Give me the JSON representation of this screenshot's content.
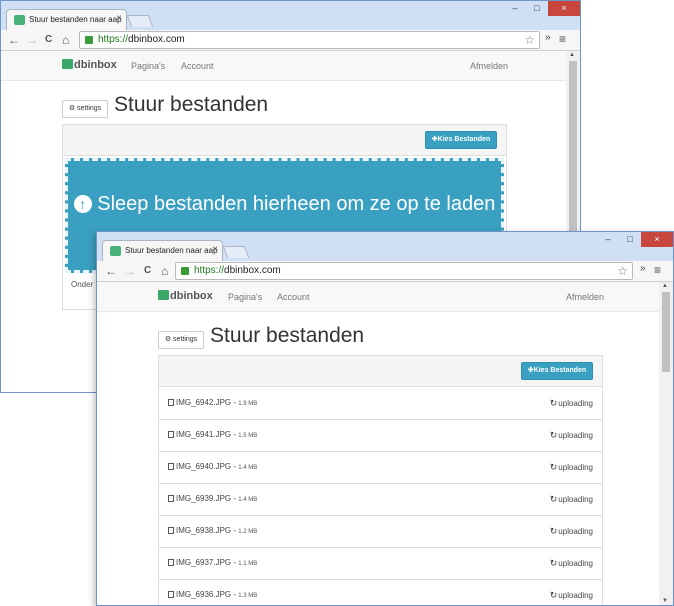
{
  "browser": {
    "tab_title": "Stuur bestanden naar aap",
    "tab_close": "×",
    "url_scheme": "https://",
    "url_host": "dbinbox.com",
    "controls": {
      "minimize": "–",
      "maximize": "□",
      "close": "×"
    },
    "extensions_glyph": "»",
    "menu_glyph": "≡",
    "back_glyph": "←",
    "forward_glyph": "→",
    "reload_glyph": "C",
    "home_glyph": "⌂",
    "star_glyph": "☆"
  },
  "site": {
    "brand": "dbinbox",
    "nav": {
      "pages": "Pagina's",
      "account": "Account",
      "logout": "Afmelden"
    },
    "settings_button": "settings",
    "settings_icon": "gear-icon",
    "page_title": "Stuur bestanden",
    "choose_button": "Kies Bestanden",
    "choose_icon": "plus-icon"
  },
  "back_window": {
    "dropzone_text": "Sleep bestanden hierheen om ze op te laden",
    "dropzone_icon": "upload-arrow-icon",
    "footer_partial": "Onder"
  },
  "files": [
    {
      "name": "IMG_6942.JPG",
      "sep": " - ",
      "size": "1.9 MB",
      "status": "uploading"
    },
    {
      "name": "IMG_6941.JPG",
      "sep": " - ",
      "size": "1.5 MB",
      "status": "uploading"
    },
    {
      "name": "IMG_6940.JPG",
      "sep": " - ",
      "size": "1.4 MB",
      "status": "uploading"
    },
    {
      "name": "IMG_6939.JPG",
      "sep": " - ",
      "size": "1.4 MB",
      "status": "uploading"
    },
    {
      "name": "IMG_6938.JPG",
      "sep": " - ",
      "size": "1.2 MB",
      "status": "uploading"
    },
    {
      "name": "IMG_6937.JPG",
      "sep": " - ",
      "size": "1.1 MB",
      "status": "uploading"
    },
    {
      "name": "IMG_6936.JPG",
      "sep": " - ",
      "size": "1.3 MB",
      "status": "uploading"
    }
  ],
  "colors": {
    "accent": "#3aa0c2",
    "brand_green": "#3aa869",
    "titlebar": "#cfe0f5",
    "close_red": "#c7463e"
  }
}
